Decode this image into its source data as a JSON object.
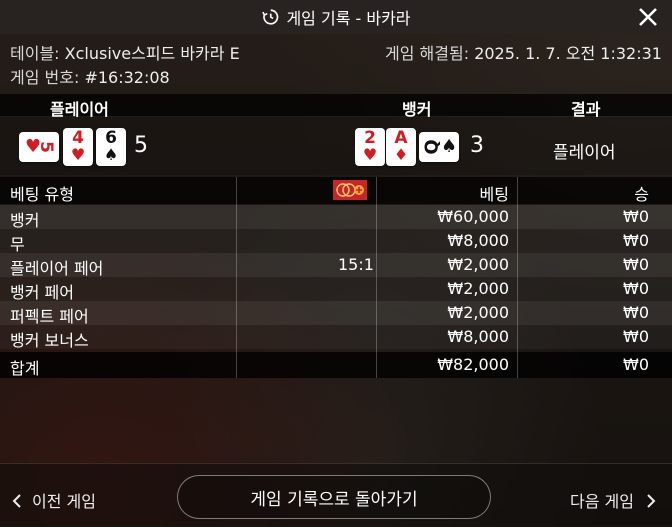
{
  "header": {
    "title": "게임 기록 - 바카라",
    "history_icon": "history-icon",
    "close_icon": "close-icon"
  },
  "info": {
    "table_label": "테이블:",
    "table_name": "Xclusive스피드 바카라 E",
    "resolved_label": "게임 해결됨:",
    "resolved_time": "2025. 1. 7. 오전 1:32:31",
    "game_no_label": "게임 번호:",
    "game_no": "#16:32:08"
  },
  "result": {
    "player_header": "플레이어",
    "banker_header": "뱅커",
    "result_header": "결과",
    "player_cards": [
      {
        "rank": "5",
        "suit": "♥",
        "side": true
      },
      {
        "rank": "4",
        "suit": "♥"
      },
      {
        "rank": "6",
        "suit": "♠"
      }
    ],
    "player_score": "5",
    "banker_cards": [
      {
        "rank": "2",
        "suit": "♥"
      },
      {
        "rank": "A",
        "suit": "♦"
      },
      {
        "rank": "Q",
        "suit": "♠",
        "side": true
      }
    ],
    "banker_score": "3",
    "result_text": "플레이어"
  },
  "bets": {
    "headers": {
      "type": "베팅 유형",
      "bet": "베팅",
      "win": "승"
    },
    "chip_icon": "chip-icon",
    "rows": [
      {
        "type": "뱅커",
        "odds": "",
        "bet": "₩60,000",
        "win": "₩0"
      },
      {
        "type": "무",
        "odds": "",
        "bet": "₩8,000",
        "win": "₩0"
      },
      {
        "type": "플레이어 페어",
        "odds": "15:1",
        "bet": "₩2,000",
        "win": "₩0"
      },
      {
        "type": "뱅커 페어",
        "odds": "",
        "bet": "₩2,000",
        "win": "₩0"
      },
      {
        "type": "퍼펙트 페어",
        "odds": "",
        "bet": "₩2,000",
        "win": "₩0"
      },
      {
        "type": "뱅커 보너스",
        "odds": "",
        "bet": "₩8,000",
        "win": "₩0"
      }
    ],
    "total": {
      "type": "합계",
      "bet": "₩82,000",
      "win": "₩0"
    }
  },
  "footer": {
    "prev_label": "이전 게임",
    "back_label": "게임 기록으로 돌아가기",
    "next_label": "다음 게임"
  },
  "colors": {
    "red_suit": "#d01c23",
    "chip": "#c8252a"
  }
}
